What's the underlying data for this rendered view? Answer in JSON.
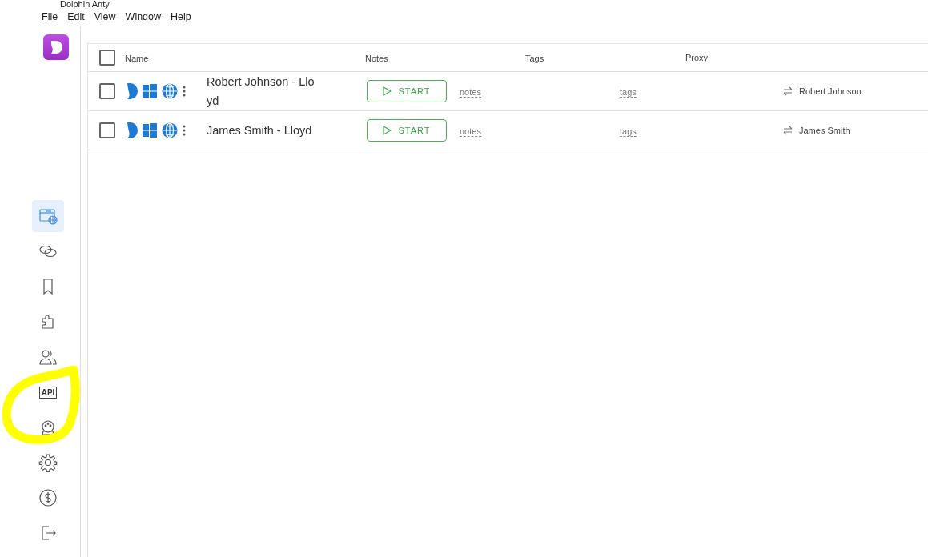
{
  "window": {
    "title": "Dolphin Anty"
  },
  "menu": [
    "File",
    "Edit",
    "View",
    "Window",
    "Help"
  ],
  "sidebar": {
    "items": [
      {
        "selected": true
      },
      {
        "selected": false
      },
      {
        "selected": false
      },
      {
        "selected": false
      },
      {
        "selected": false
      },
      {
        "selected": false,
        "label": "API"
      },
      {
        "selected": false
      },
      {
        "selected": false
      },
      {
        "selected": false
      },
      {
        "selected": false
      }
    ]
  },
  "table": {
    "select_all": {
      "checked": false
    },
    "columns": [
      "Name",
      "Notes",
      "Tags",
      "Proxy"
    ],
    "rows": [
      {
        "checked": false,
        "name": "Robert Johnson - Lloyd",
        "action": "START",
        "notes": "notes",
        "tags": "tags",
        "proxy": "Robert Johnson"
      },
      {
        "checked": false,
        "name": "James Smith - Lloyd",
        "action": "START",
        "notes": "notes",
        "tags": "tags",
        "proxy": "James Smith"
      }
    ]
  }
}
